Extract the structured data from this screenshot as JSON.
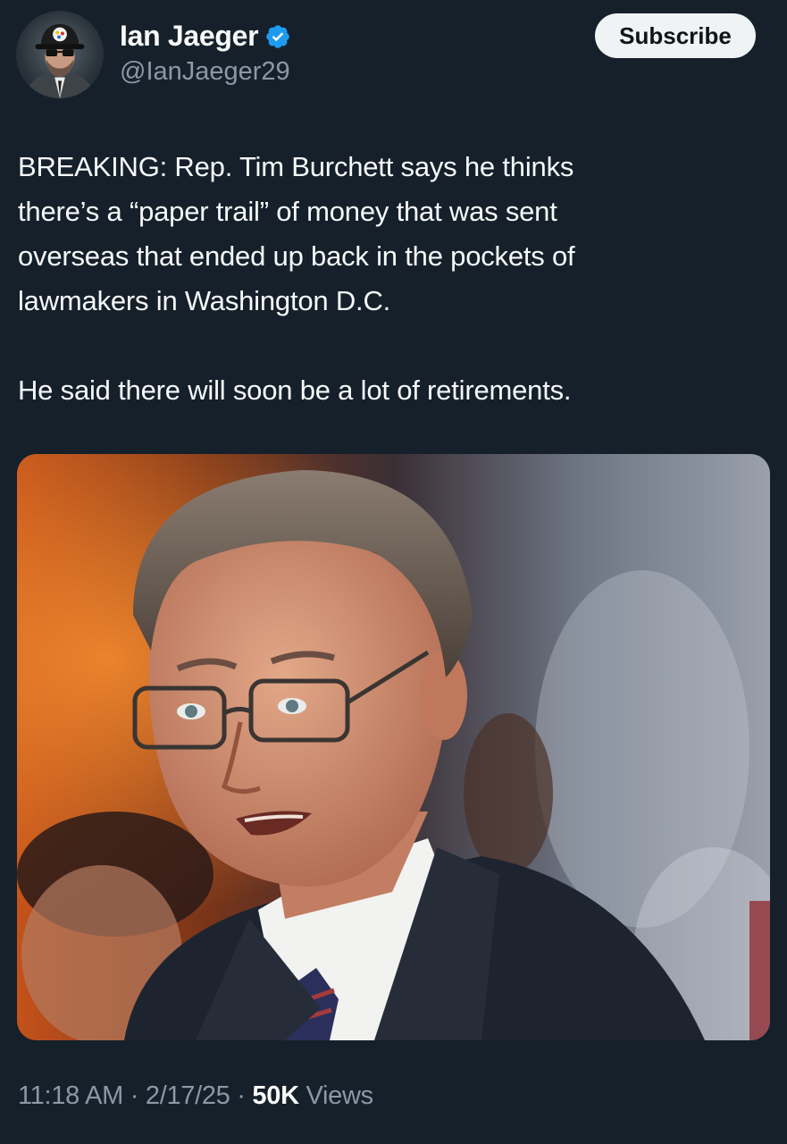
{
  "author": {
    "display_name": "Ian Jaeger",
    "handle": "@IanJaeger29",
    "verified": true,
    "avatar_icon": "avatar-steelers-cap-icon",
    "verified_icon": "verified-badge-icon",
    "verified_color": "#1d9bf0"
  },
  "header": {
    "subscribe_label": "Subscribe"
  },
  "tweet": {
    "paragraph_1": "BREAKING: Rep. Tim Burchett says he thinks\nthere’s a “paper trail” of money that was sent\noverseas that ended up back in the pockets of\nlawmakers in Washington D.C.",
    "paragraph_2": "He said there will soon be a lot of retirements.",
    "media_icon": "photo-of-man-in-glasses"
  },
  "meta": {
    "time": "11:18 AM",
    "sep1": " · ",
    "date": "2/17/25",
    "sep2": " · ",
    "views_count": "50K",
    "views_label": " Views"
  },
  "colors": {
    "background": "#15202b",
    "text_primary": "#f7f9f9",
    "text_secondary": "#8b98a5",
    "button_bg": "#eff3f4"
  }
}
